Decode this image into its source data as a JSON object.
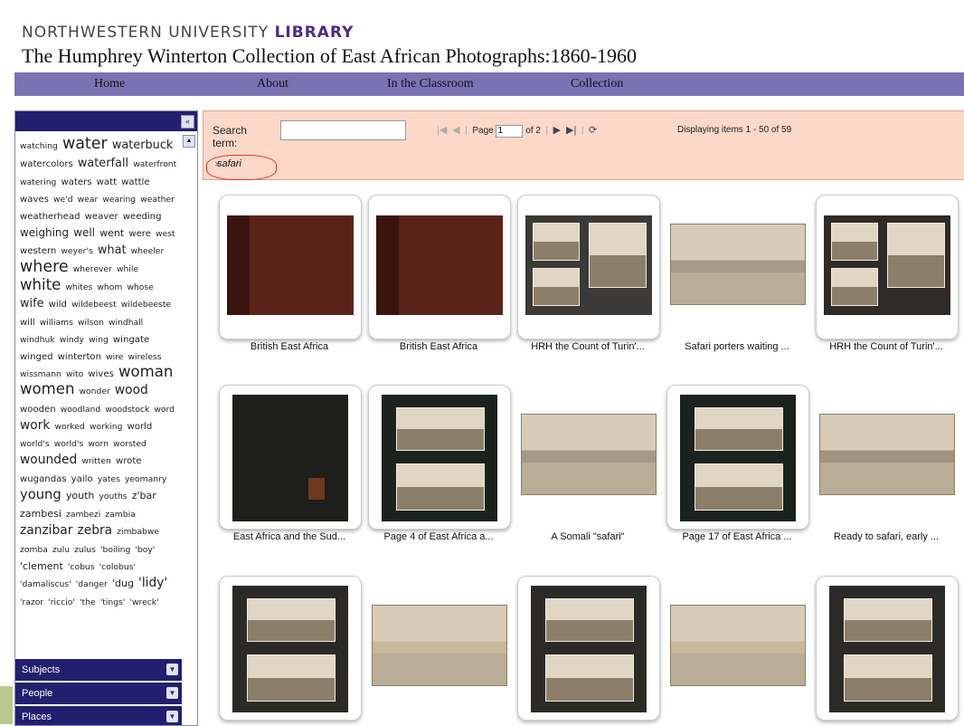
{
  "header": {
    "brand_prefix": "NORTHWESTERN UNIVERSITY",
    "brand_bold": "LIBRARY",
    "title": "The Humphrey Winterton Collection of East African Photographs:1860-1960"
  },
  "nav": [
    {
      "label": "Home"
    },
    {
      "label": "About"
    },
    {
      "label": "In the Classroom"
    },
    {
      "label": "Collection"
    }
  ],
  "sidebar": {
    "collapse_icon": "double-chevron-left-icon",
    "accordion": [
      {
        "label": "Subjects"
      },
      {
        "label": "People"
      },
      {
        "label": "Places"
      }
    ],
    "tag_cloud": [
      {
        "w": "watching",
        "s": 10
      },
      {
        "w": "water",
        "s": 19
      },
      {
        "w": "waterbuck",
        "s": 14
      },
      {
        "w": "watercolors",
        "s": 11
      },
      {
        "w": "waterfall",
        "s": 14
      },
      {
        "w": "waterfront",
        "s": 10
      },
      {
        "w": "watering",
        "s": 10
      },
      {
        "w": "waters",
        "s": 11
      },
      {
        "w": "watt",
        "s": 11
      },
      {
        "w": "wattle",
        "s": 11
      },
      {
        "w": "waves",
        "s": 11
      },
      {
        "w": "we'd",
        "s": 10
      },
      {
        "w": "wear",
        "s": 10
      },
      {
        "w": "wearing",
        "s": 10
      },
      {
        "w": "weather",
        "s": 10
      },
      {
        "w": "weatherhead",
        "s": 11
      },
      {
        "w": "weaver",
        "s": 11
      },
      {
        "w": "weeding",
        "s": 11
      },
      {
        "w": "weighing",
        "s": 13
      },
      {
        "w": "well",
        "s": 13
      },
      {
        "w": "went",
        "s": 12
      },
      {
        "w": "were",
        "s": 11
      },
      {
        "w": "west",
        "s": 10
      },
      {
        "w": "western",
        "s": 11
      },
      {
        "w": "weyer's",
        "s": 10
      },
      {
        "w": "what",
        "s": 14
      },
      {
        "w": "wheeler",
        "s": 10
      },
      {
        "w": "where",
        "s": 19
      },
      {
        "w": "wherever",
        "s": 10
      },
      {
        "w": "while",
        "s": 10
      },
      {
        "w": "white",
        "s": 18
      },
      {
        "w": "whites",
        "s": 10
      },
      {
        "w": "whom",
        "s": 10
      },
      {
        "w": "whose",
        "s": 10
      },
      {
        "w": "wife",
        "s": 14
      },
      {
        "w": "wild",
        "s": 11
      },
      {
        "w": "wildebeest",
        "s": 10
      },
      {
        "w": "wildebeeste",
        "s": 10
      },
      {
        "w": "will",
        "s": 11
      },
      {
        "w": "williams",
        "s": 10
      },
      {
        "w": "wilson",
        "s": 10
      },
      {
        "w": "windhall",
        "s": 10
      },
      {
        "w": "windhuk",
        "s": 10
      },
      {
        "w": "windy",
        "s": 10
      },
      {
        "w": "wing",
        "s": 10
      },
      {
        "w": "wingate",
        "s": 11
      },
      {
        "w": "winged",
        "s": 11
      },
      {
        "w": "winterton",
        "s": 11
      },
      {
        "w": "wire",
        "s": 10
      },
      {
        "w": "wireless",
        "s": 10
      },
      {
        "w": "wissmann",
        "s": 10
      },
      {
        "w": "wito",
        "s": 10
      },
      {
        "w": "wives",
        "s": 11
      },
      {
        "w": "woman",
        "s": 18
      },
      {
        "w": "women",
        "s": 18
      },
      {
        "w": "wonder",
        "s": 10
      },
      {
        "w": "wood",
        "s": 15
      },
      {
        "w": "wooden",
        "s": 11
      },
      {
        "w": "woodland",
        "s": 10
      },
      {
        "w": "woodstock",
        "s": 10
      },
      {
        "w": "word",
        "s": 10
      },
      {
        "w": "work",
        "s": 15
      },
      {
        "w": "worked",
        "s": 10
      },
      {
        "w": "working",
        "s": 10
      },
      {
        "w": "world",
        "s": 11
      },
      {
        "w": "world's",
        "s": 10
      },
      {
        "w": "world's",
        "s": 10
      },
      {
        "w": "worn",
        "s": 10
      },
      {
        "w": "worsted",
        "s": 10
      },
      {
        "w": "wounded",
        "s": 15
      },
      {
        "w": "written",
        "s": 10
      },
      {
        "w": "wrote",
        "s": 11
      },
      {
        "w": "wugandas",
        "s": 11
      },
      {
        "w": "yailo",
        "s": 11
      },
      {
        "w": "yates",
        "s": 10
      },
      {
        "w": "yeomanry",
        "s": 10
      },
      {
        "w": "young",
        "s": 16
      },
      {
        "w": "youth",
        "s": 12
      },
      {
        "w": "youths",
        "s": 10
      },
      {
        "w": "z'bar",
        "s": 12
      },
      {
        "w": "zambesi",
        "s": 12
      },
      {
        "w": "zambezi",
        "s": 10
      },
      {
        "w": "zambia",
        "s": 10
      },
      {
        "w": "zanzibar",
        "s": 15
      },
      {
        "w": "zebra",
        "s": 15
      },
      {
        "w": "zimbabwe",
        "s": 10
      },
      {
        "w": "zomba",
        "s": 10
      },
      {
        "w": "zulu",
        "s": 10
      },
      {
        "w": "zulus",
        "s": 10
      },
      {
        "w": "'boiling",
        "s": 10
      },
      {
        "w": "'boy'",
        "s": 10
      },
      {
        "w": "'clement",
        "s": 12
      },
      {
        "w": "'cobus",
        "s": 10
      },
      {
        "w": "'colobus'",
        "s": 10
      },
      {
        "w": "'damaliscus'",
        "s": 10
      },
      {
        "w": "'danger",
        "s": 10
      },
      {
        "w": "'dug",
        "s": 12
      },
      {
        "w": "'lidy'",
        "s": 15
      },
      {
        "w": "'razor",
        "s": 10
      },
      {
        "w": "'riccio'",
        "s": 10
      },
      {
        "w": "'the",
        "s": 10
      },
      {
        "w": "'tings'",
        "s": 10
      },
      {
        "w": "'wreck'",
        "s": 10
      }
    ]
  },
  "search": {
    "label": "Search term:",
    "input_value": "",
    "active_term": "safari",
    "remove_icon": "remove-x-icon"
  },
  "pager": {
    "page_label": "Page",
    "page_value": "1",
    "of_label": "of 2",
    "displaying": "Displaying items 1 - 50 of 59",
    "icons": [
      "first-page-icon",
      "prev-page-icon",
      "next-page-icon",
      "last-page-icon",
      "refresh-icon"
    ]
  },
  "results": [
    {
      "caption": "British East Africa",
      "tone": "#5a2318",
      "kind": "cover"
    },
    {
      "caption": "British East Africa",
      "tone": "#5a2318",
      "kind": "cover"
    },
    {
      "caption": "HRH the Count of Turin'...",
      "tone": "#3c3a38",
      "kind": "album"
    },
    {
      "caption": "Safari porters waiting ...",
      "tone": "#a89a86",
      "kind": "print",
      "frameless": true
    },
    {
      "caption": "HRH the Count of Turin'...",
      "tone": "#2e2b28",
      "kind": "album"
    },
    {
      "caption": "East Africa and the Sud...",
      "tone": "#1e1e1b",
      "kind": "book"
    },
    {
      "caption": "Page 4 of East Africa a...",
      "tone": "#1c221d",
      "kind": "album2"
    },
    {
      "caption": "A Somali \"safari\"",
      "tone": "#a29a88",
      "kind": "print",
      "frameless": true
    },
    {
      "caption": "Page 17 of East Africa ...",
      "tone": "#1c221d",
      "kind": "album2"
    },
    {
      "caption": "Ready to safari, early ...",
      "tone": "#a09480",
      "kind": "print",
      "frameless": true
    },
    {
      "caption": "",
      "tone": "#2b2a27",
      "kind": "album2"
    },
    {
      "caption": "",
      "tone": "#c8b89c",
      "kind": "print",
      "frameless": true
    },
    {
      "caption": "",
      "tone": "#2b2a27",
      "kind": "album2"
    },
    {
      "caption": "",
      "tone": "#c8b89c",
      "kind": "print",
      "frameless": true
    },
    {
      "caption": "",
      "tone": "#2b2a27",
      "kind": "album2"
    }
  ]
}
